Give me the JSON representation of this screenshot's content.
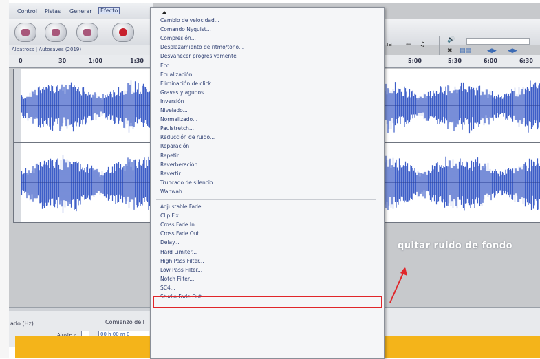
{
  "app": {
    "menus": [
      "Control",
      "Pistas",
      "Generar",
      "Efecto"
    ],
    "track_info": "Albatross | Autosaves (2019)",
    "ruler_ticks": [
      "0",
      "30",
      "1:00",
      "1:30",
      "5:00",
      "5:30",
      "6:00",
      "6:30"
    ],
    "lower": {
      "rate_label": "ado (Hz)",
      "selection_label": "Comienzo de l",
      "snap_label": "Ajuste a",
      "time_value": "00 h 00 m 0"
    }
  },
  "effect_menu": {
    "groups": [
      [
        "Cambio de velocidad...",
        "Comando Nyquist...",
        "Compresión...",
        "Desplazamiento de ritmo/tono...",
        "Desvanecer progresivamente",
        "Eco...",
        "Ecualización...",
        "Eliminación de click...",
        "Graves y agudos...",
        "Inversión",
        "Nivelado...",
        "Normalizado...",
        "Paulstretch...",
        "Reducción de ruido...",
        "Reparación",
        "Repetir...",
        "Reverberación...",
        "Revertir",
        "Truncado de silencio...",
        "Wahwah..."
      ],
      [
        "Adjustable Fade...",
        "Clip Fix...",
        "Cross Fade In",
        "Cross Fade Out",
        "Delay...",
        "Hard Limiter...",
        "High Pass Filter...",
        "Low Pass Filter...",
        "Notch Filter...",
        "SC4...",
        "Studio Fade Out"
      ]
    ],
    "highlighted": "High Pass Filter..."
  },
  "annotation": "quitar ruido de fondo",
  "colors": {
    "accent_bar": "#f4b41a",
    "highlight_box": "#e0262a",
    "waveform": "#3d5ec8",
    "annotation_arrow": "#e0262a"
  },
  "icons": [
    "up-arrow-icon",
    "speaker-icon",
    "cursor-icon",
    "zoom-icon"
  ]
}
